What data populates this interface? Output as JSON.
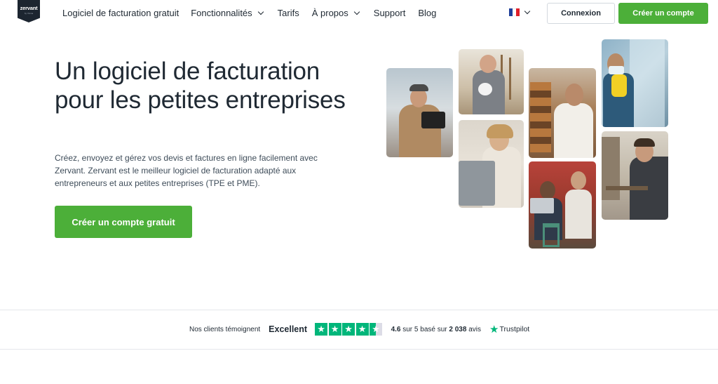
{
  "nav": {
    "logo_text": "zervant",
    "logo_sub": "by Visma",
    "links": [
      {
        "label": "Logiciel de facturation gratuit",
        "dropdown": false
      },
      {
        "label": "Fonctionnalités",
        "dropdown": true
      },
      {
        "label": "Tarifs",
        "dropdown": false
      },
      {
        "label": "À propos",
        "dropdown": true
      },
      {
        "label": "Support",
        "dropdown": false
      },
      {
        "label": "Blog",
        "dropdown": false
      }
    ],
    "language_flag": "french-flag-icon",
    "login_label": "Connexion",
    "signup_label": "Créer un compte"
  },
  "hero": {
    "title": "Un logiciel de facturation pour les petites entreprises",
    "description": "Créez, envoyez et gérez vos devis et factures en ligne facilement avec Zervant. Zervant est le meilleur logiciel de facturation adapté aux entrepreneurs et aux petites entreprises (TPE et PME).",
    "cta_label": "Créer un compte gratuit"
  },
  "trust": {
    "clients_label": "Nos clients témoignent",
    "rating_word": "Excellent",
    "stars": 4.5,
    "score_prefix": "4.6",
    "score_text": " sur 5 basé sur ",
    "review_count": "2 038",
    "reviews_label": " avis",
    "provider": "Trustpilot"
  },
  "colors": {
    "brand_green": "#4caf39",
    "trustpilot_green": "#00b67a",
    "text_dark": "#1f2933"
  }
}
